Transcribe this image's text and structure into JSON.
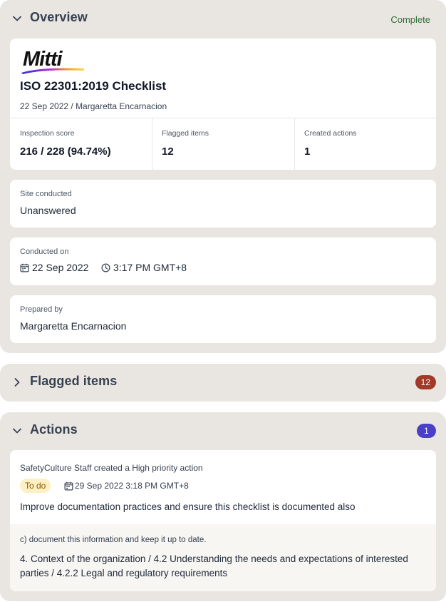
{
  "overview": {
    "title": "Overview",
    "status": "Complete",
    "logo_text": "Mitti",
    "doc_title": "ISO 22301:2019 Checklist",
    "doc_subtitle": "22 Sep 2022 / Margaretta Encarnacion",
    "stats": [
      {
        "label": "Inspection score",
        "value": "216 / 228 (94.74%)"
      },
      {
        "label": "Flagged items",
        "value": "12"
      },
      {
        "label": "Created actions",
        "value": "1"
      }
    ],
    "site": {
      "label": "Site conducted",
      "value": "Unanswered"
    },
    "conducted": {
      "label": "Conducted on",
      "date": "22 Sep 2022",
      "time": "3:17 PM GMT+8"
    },
    "prepared": {
      "label": "Prepared by",
      "value": "Margaretta Encarnacion"
    }
  },
  "flagged": {
    "title": "Flagged items",
    "count": "12",
    "badge_color": "#a23a2a"
  },
  "actions": {
    "title": "Actions",
    "count": "1",
    "badge_color": "#4a40c8",
    "item": {
      "author": "SafetyCulture Staff created a High priority action",
      "status": "To do",
      "due": "29 Sep 2022 3:18 PM GMT+8",
      "title": "Improve documentation practices and ensure this checklist is documented also",
      "question": "c) document this information and keep it up to date.",
      "path": "4. Context of the organization / 4.2 Understanding the needs and expectations of interested parties / 4.2.2 Legal and regulatory requirements"
    }
  },
  "colors": {
    "panel_bg": "#e9e6e1",
    "complete_green": "#2f6e35",
    "todo_bg": "#fdf0c4"
  },
  "icons": [
    "chevron-down-icon",
    "chevron-right-icon",
    "calendar-icon",
    "clock-icon"
  ]
}
